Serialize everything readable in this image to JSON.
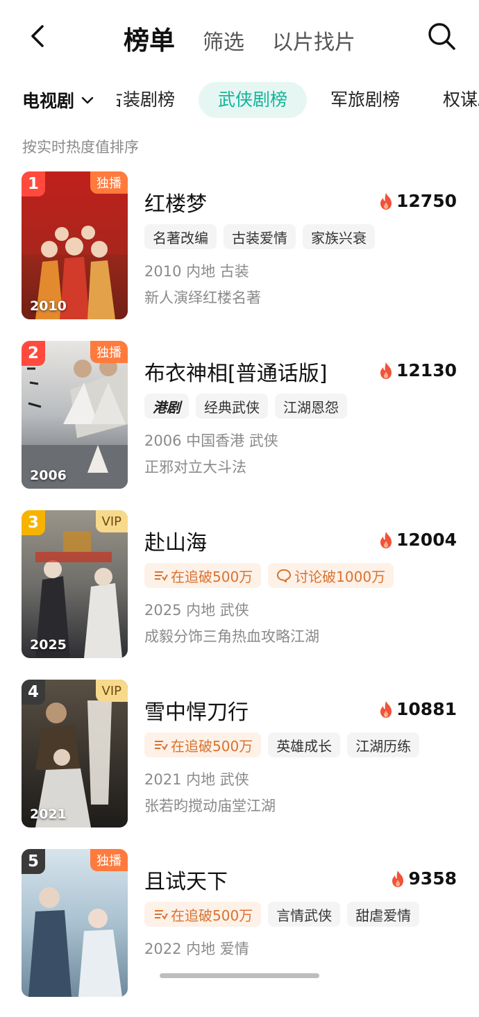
{
  "nav": {
    "tabs": [
      "榜单",
      "筛选",
      "以片找片"
    ]
  },
  "category": {
    "dropdown_label": "电视剧",
    "items": [
      "古装剧榜",
      "武侠剧榜",
      "军旅剧榜",
      "权谋剧榜"
    ],
    "active_index": 1
  },
  "sort_hint": "按实时热度值排序",
  "colors": {
    "accent": "#12b39a",
    "rank_top": "#ff4a3d",
    "rank_3": "#f6b300",
    "rank_other": "#3a3a3a",
    "exclusive_badge": "#ff7a3d",
    "vip_badge": "#f7d98c"
  },
  "items": [
    {
      "rank": "1",
      "badge": "独播",
      "poster_year": "2010",
      "title": "红楼梦",
      "heat": "12750",
      "tags": [
        {
          "label": "名著改编"
        },
        {
          "label": "古装爱情"
        },
        {
          "label": "家族兴衰"
        }
      ],
      "meta": "2010 内地 古装",
      "desc": "新人演绎红楼名著"
    },
    {
      "rank": "2",
      "badge": "独播",
      "poster_year": "2006",
      "title": "布衣神相[普通话版]",
      "heat": "12130",
      "tags": [
        {
          "label": "港剧"
        },
        {
          "label": "经典武侠"
        },
        {
          "label": "江湖恩怨"
        }
      ],
      "meta": "2006 中国香港 武侠",
      "desc": "正邪对立大斗法"
    },
    {
      "rank": "3",
      "badge": "VIP",
      "poster_year": "2025",
      "title": "赴山海",
      "heat": "12004",
      "tags": [
        {
          "label": "在追破500万",
          "icon": "list-icon"
        },
        {
          "label": "讨论破1000万",
          "icon": "chat-bubble-icon"
        }
      ],
      "meta": "2025 内地 武侠",
      "desc": "成毅分饰三角热血攻略江湖"
    },
    {
      "rank": "4",
      "badge": "VIP",
      "poster_year": "2021",
      "title": "雪中悍刀行",
      "heat": "10881",
      "tags": [
        {
          "label": "在追破500万",
          "icon": "list-icon"
        },
        {
          "label": "英雄成长"
        },
        {
          "label": "江湖历练"
        }
      ],
      "meta": "2021 内地 武侠",
      "desc": "张若昀搅动庙堂江湖"
    },
    {
      "rank": "5",
      "badge": "独播",
      "poster_year": "",
      "title": "且试天下",
      "heat": "9358",
      "tags": [
        {
          "label": "在追破500万",
          "icon": "list-icon"
        },
        {
          "label": "言情武侠"
        },
        {
          "label": "甜虐爱情"
        }
      ],
      "meta": "2022 内地 爱情",
      "desc": ""
    }
  ]
}
